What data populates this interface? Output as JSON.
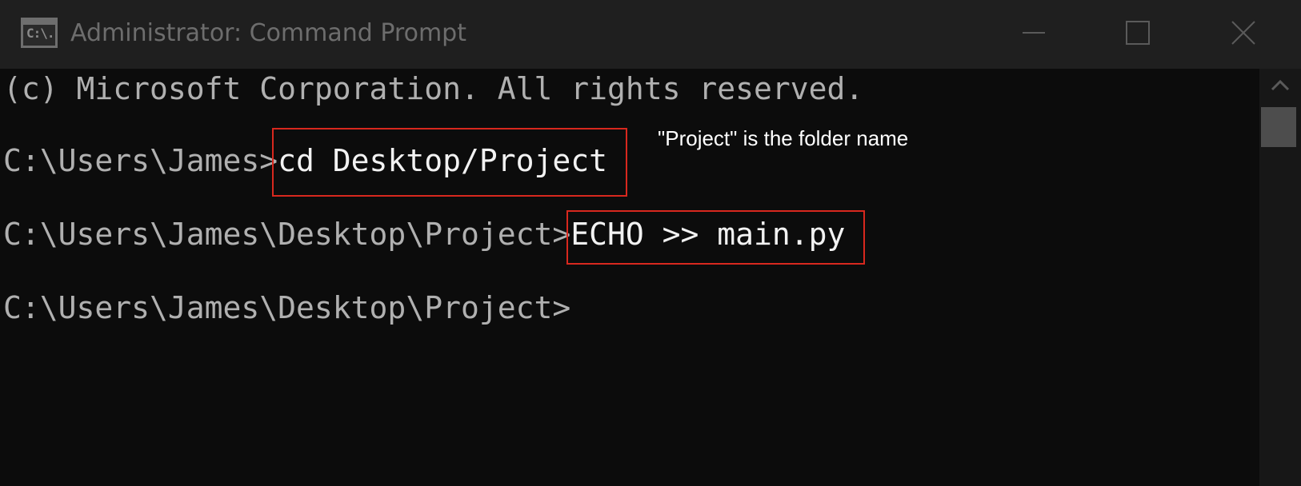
{
  "window": {
    "title": "Administrator: Command Prompt",
    "icon": "cmd-icon",
    "icon_text": "C:\\.",
    "controls": [
      "minimize-icon",
      "maximize-icon",
      "close-icon"
    ]
  },
  "console": {
    "lines": [
      {
        "prompt": "(c) Microsoft Corporation. All rights reserved.",
        "command": ""
      },
      {
        "prompt": "C:\\Users\\James>",
        "command": "cd Desktop/Project"
      },
      {
        "prompt": "C:\\Users\\James\\Desktop\\Project>",
        "command": "ECHO >> main.py"
      },
      {
        "prompt": "C:\\Users\\James\\Desktop\\Project>",
        "command": ""
      }
    ]
  },
  "annotation": {
    "text": "\"Project\" is the folder name",
    "highlight_color": "#d8281e"
  },
  "colors": {
    "background": "#0c0c0c",
    "titlebar": "#1f1f1f",
    "prompt_text": "#b0b0b0",
    "command_text": "#f2f2f2",
    "annotation_text": "#ffffff"
  }
}
